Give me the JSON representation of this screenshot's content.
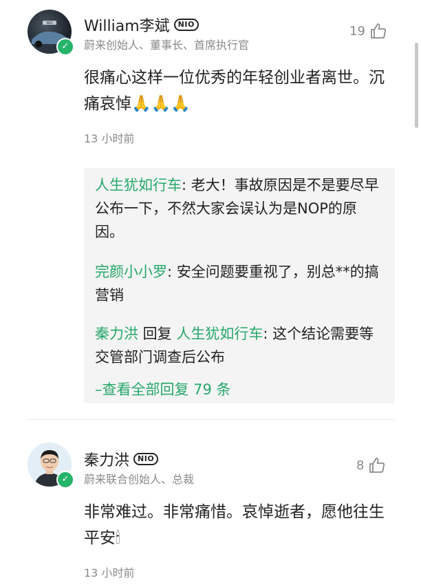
{
  "comments": [
    {
      "name": "William李斌",
      "badge": "NIO",
      "subtitle": "蔚来创始人、董事长、首席执行官",
      "likes": "19",
      "text": "很痛心这样一位优秀的年轻创业者离世。沉痛哀悼🙏🙏🙏",
      "time": "13 小时前",
      "avatar_brand": "NIO",
      "replies": [
        {
          "author": "人生犹如行车",
          "sep": ": ",
          "text": "老大！事故原因是不是要尽早公布一下，不然大家会误认为是NOP的原因。"
        },
        {
          "author": "完颜小小罗",
          "sep": ": ",
          "text": "安全问题要重视了，别总**的搞营销"
        },
        {
          "author": "秦力洪",
          "mid": " 回复 ",
          "target": "人生犹如行车",
          "sep": ": ",
          "text": "这个结论需要等交管部门调查后公布"
        }
      ],
      "view_all": "–查看全部回复 79 条"
    },
    {
      "name": "秦力洪",
      "badge": "NIO",
      "subtitle": "蔚来联合创始人、总裁",
      "likes": "8",
      "text": "非常难过。非常痛惜。哀悼逝者，愿他往生平安🕯",
      "time": "13 小时前"
    }
  ],
  "icons": {
    "like": "thumbs-up-icon",
    "verified": "verified-check-icon",
    "prayer": "prayer-hands-icon",
    "candle": "candle-icon"
  },
  "colors": {
    "accent": "#26a86a",
    "verified": "#26b36a",
    "muted": "#8a8a8a"
  }
}
